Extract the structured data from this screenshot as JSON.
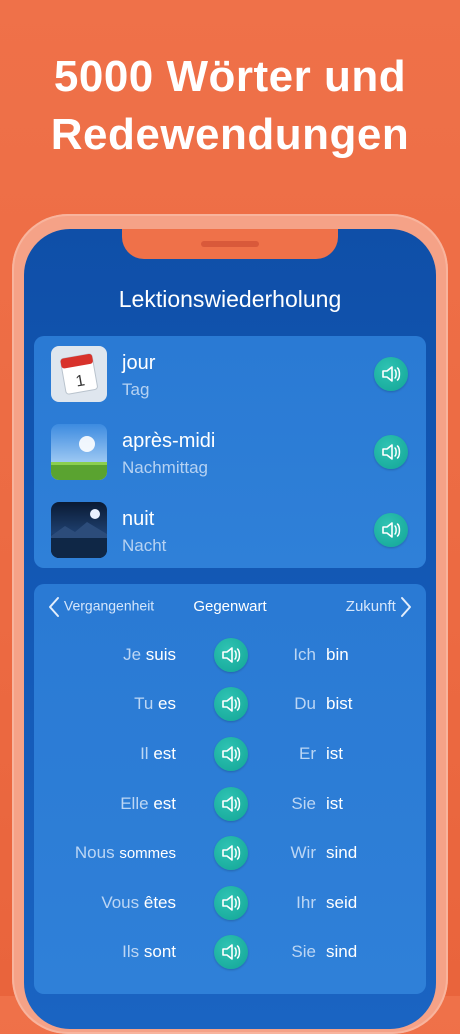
{
  "headline": {
    "line1": "5000 Wörter und",
    "line2": "Redewendungen"
  },
  "screen": {
    "title": "Lektionswiederholung"
  },
  "vocab": [
    {
      "word": "jour",
      "translation": "Tag",
      "icon": "calendar-icon"
    },
    {
      "word": "après-midi",
      "translation": "Nachmittag",
      "icon": "afternoon-sky-icon"
    },
    {
      "word": "nuit",
      "translation": "Nacht",
      "icon": "night-sky-icon"
    }
  ],
  "tense_nav": {
    "prev": "Vergangenheit",
    "current": "Gegenwart",
    "next": "Zukunft"
  },
  "conjugation": [
    {
      "fr_pronoun": "Je",
      "fr_verb": "suis",
      "de_pronoun": "Ich",
      "de_verb": "bin"
    },
    {
      "fr_pronoun": "Tu",
      "fr_verb": "es",
      "de_pronoun": "Du",
      "de_verb": "bist"
    },
    {
      "fr_pronoun": "Il",
      "fr_verb": "est",
      "de_pronoun": "Er",
      "de_verb": "ist"
    },
    {
      "fr_pronoun": "Elle",
      "fr_verb": "est",
      "de_pronoun": "Sie",
      "de_verb": "ist"
    },
    {
      "fr_pronoun": "Nous",
      "fr_verb": "sommes",
      "de_pronoun": "Wir",
      "de_verb": "sind"
    },
    {
      "fr_pronoun": "Vous",
      "fr_verb": "êtes",
      "de_pronoun": "Ihr",
      "de_verb": "seid"
    },
    {
      "fr_pronoun": "Ils",
      "fr_verb": "sont",
      "de_pronoun": "Sie",
      "de_verb": "sind"
    }
  ],
  "colors": {
    "background": "#ef7149",
    "screen": "#1358b5",
    "card": "#2f80d8",
    "speaker_button": "#1fb5a5"
  }
}
